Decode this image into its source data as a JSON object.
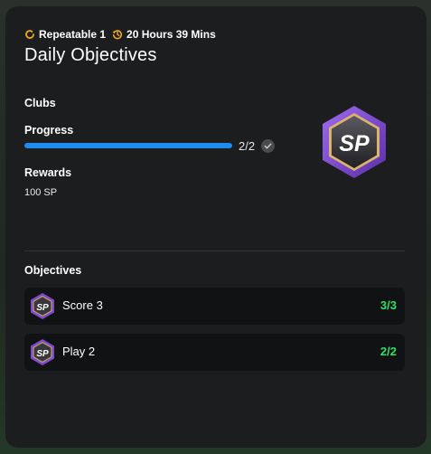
{
  "header": {
    "repeatable_label": "Repeatable 1",
    "timer_label": "20 Hours 39 Mins",
    "title": "Daily Objectives",
    "repeat_icon": "repeat-icon",
    "timer_icon": "history-clock-icon"
  },
  "details": {
    "category": "Clubs",
    "progress_label": "Progress",
    "progress_text": "2/2",
    "progress_fraction": 1.0,
    "rewards_label": "Rewards",
    "reward_value": "100 SP",
    "badge_text": "SP",
    "check_icon": "checkmark-icon"
  },
  "objectives": {
    "label": "Objectives",
    "items": [
      {
        "label": "Score 3",
        "count": "3/3",
        "badge_text": "SP"
      },
      {
        "label": "Play 2",
        "count": "2/2",
        "badge_text": "SP"
      }
    ]
  },
  "colors": {
    "accent_blue": "#1f8cf0",
    "complete_green": "#2ee065",
    "icon_orange": "#f0a51c",
    "badge_purple": "#8a4fd8",
    "badge_gold": "#d8b56a"
  }
}
